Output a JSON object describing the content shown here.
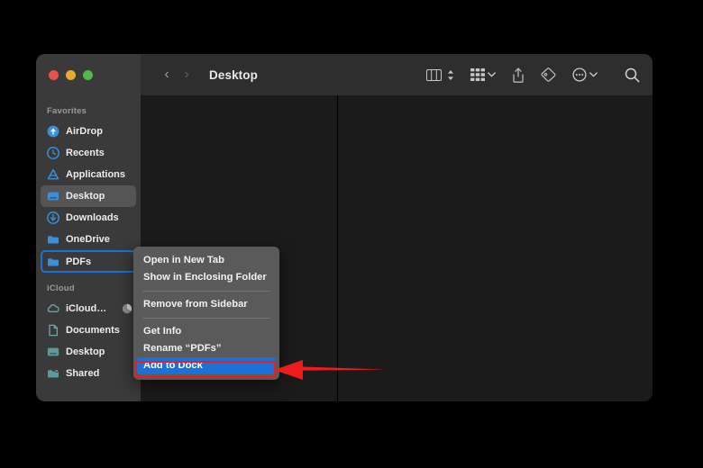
{
  "window": {
    "title": "Desktop",
    "traffic_lights": [
      {
        "name": "close",
        "color": "#e8524a"
      },
      {
        "name": "minimize",
        "color": "#e3ad2e"
      },
      {
        "name": "zoom",
        "color": "#54b74a"
      }
    ]
  },
  "toolbar": {
    "back_label": "‹",
    "forward_label": "›",
    "view_icon": "column-view-icon",
    "arrange_icon": "grid-arrange-icon",
    "share_icon": "share-icon",
    "tag_icon": "tag-icon",
    "more_icon": "more-ellipsis-icon",
    "search_icon": "search-icon"
  },
  "sidebar": {
    "sections": [
      {
        "header": "Favorites",
        "items": [
          {
            "label": "AirDrop",
            "icon": "airdrop-icon",
            "state": "normal"
          },
          {
            "label": "Recents",
            "icon": "recents-clock-icon",
            "state": "normal"
          },
          {
            "label": "Applications",
            "icon": "applications-icon",
            "state": "normal"
          },
          {
            "label": "Desktop",
            "icon": "desktop-icon",
            "state": "selected"
          },
          {
            "label": "Downloads",
            "icon": "downloads-icon",
            "state": "normal"
          },
          {
            "label": "OneDrive",
            "icon": "folder-icon",
            "state": "normal"
          },
          {
            "label": "PDFs",
            "icon": "folder-icon",
            "state": "outlined"
          }
        ]
      },
      {
        "header": "iCloud",
        "items": [
          {
            "label": "iCloud…",
            "icon": "icloud-icon",
            "state": "normal",
            "badge": "sync-progress"
          },
          {
            "label": "Documents",
            "icon": "document-icon",
            "state": "normal"
          },
          {
            "label": "Desktop",
            "icon": "desktop-icon",
            "state": "normal"
          },
          {
            "label": "Shared",
            "icon": "shared-folder-icon",
            "state": "normal"
          }
        ]
      }
    ]
  },
  "context_menu": {
    "items": [
      {
        "label": "Open in New Tab",
        "highlighted": false,
        "separator_after": false
      },
      {
        "label": "Show in Enclosing Folder",
        "highlighted": false,
        "separator_after": true
      },
      {
        "label": "Remove from Sidebar",
        "highlighted": false,
        "separator_after": true
      },
      {
        "label": "Get Info",
        "highlighted": false,
        "separator_after": false
      },
      {
        "label": "Rename “PDFs”",
        "highlighted": false,
        "separator_after": false
      },
      {
        "label": "Add to Dock",
        "highlighted": true,
        "separator_after": false
      }
    ]
  },
  "annotations": {
    "highlight_color": "#ee1c1c",
    "arrow_direction": "left",
    "target_item": "Add to Dock"
  },
  "colors": {
    "accent_blue": "#1a72d8",
    "sidebar_bg": "#3a3a3a",
    "toolbar_bg": "#2e2e2e",
    "content_bg": "#1b1b1b",
    "menu_bg": "#5a5a5a",
    "favorites_icon": "#3b8fd8",
    "icloud_icon": "#5e9a9a"
  }
}
